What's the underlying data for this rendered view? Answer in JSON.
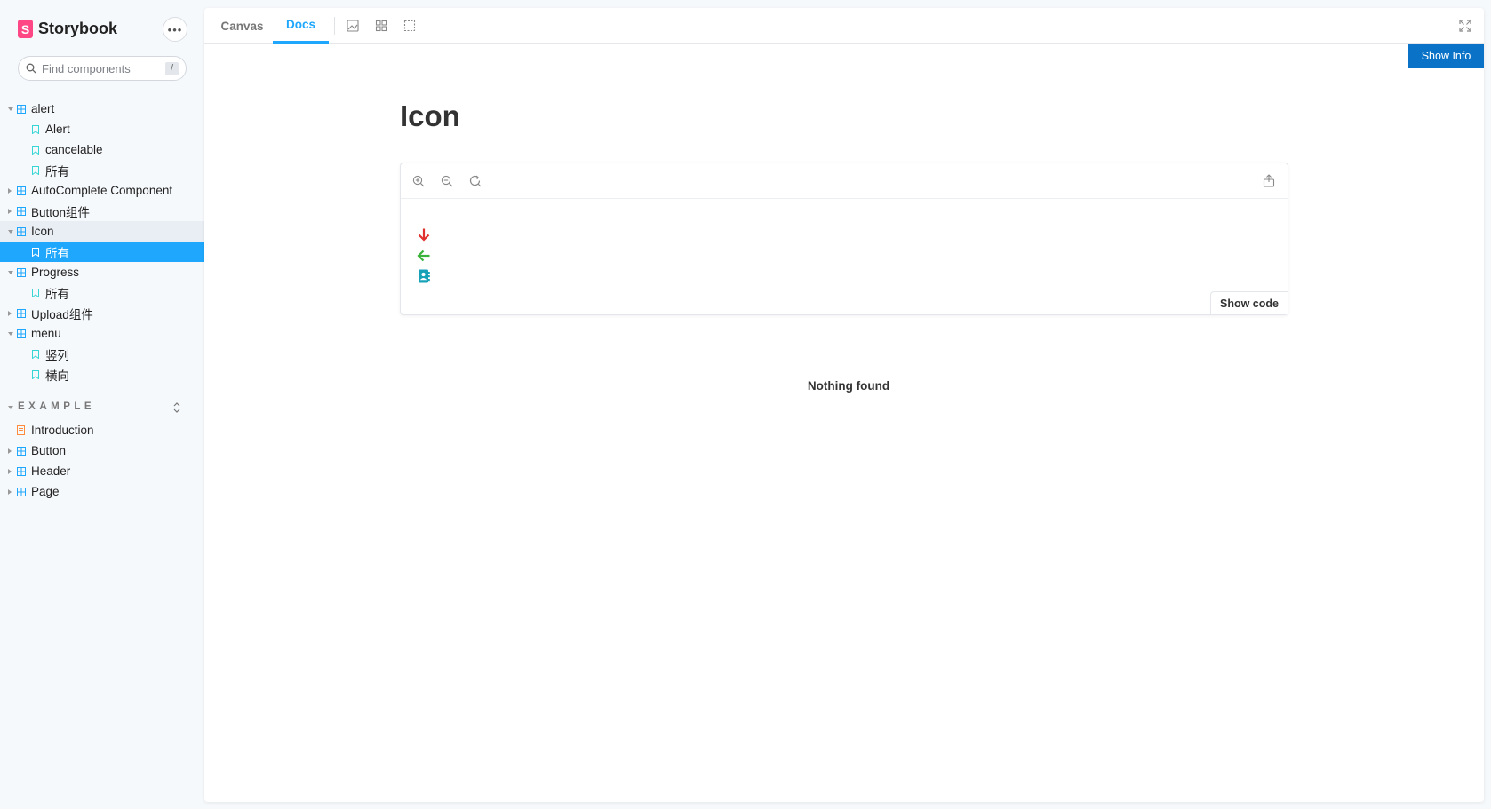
{
  "brand": {
    "name": "Storybook",
    "logo_letter": "S",
    "more_label": "•••"
  },
  "search": {
    "placeholder": "Find components",
    "shortcut": "/"
  },
  "tree": [
    {
      "label": "alert",
      "kind": "component",
      "expanded": true
    },
    {
      "label": "Alert",
      "kind": "story"
    },
    {
      "label": "cancelable",
      "kind": "story"
    },
    {
      "label": "所有",
      "kind": "story"
    },
    {
      "label": "AutoComplete Component",
      "kind": "component",
      "expanded": false
    },
    {
      "label": "Button组件",
      "kind": "component",
      "expanded": false
    },
    {
      "label": "Icon",
      "kind": "component",
      "expanded": true
    },
    {
      "label": "所有",
      "kind": "story",
      "selected": true
    },
    {
      "label": "Progress",
      "kind": "component",
      "expanded": true
    },
    {
      "label": "所有",
      "kind": "story"
    },
    {
      "label": "Upload组件",
      "kind": "component",
      "expanded": false
    },
    {
      "label": "menu",
      "kind": "component",
      "expanded": true
    },
    {
      "label": "竖列",
      "kind": "story"
    },
    {
      "label": "横向",
      "kind": "story"
    }
  ],
  "section": {
    "title": "EXAMPLE",
    "items": [
      {
        "label": "Introduction",
        "kind": "docs"
      },
      {
        "label": "Button",
        "kind": "component"
      },
      {
        "label": "Header",
        "kind": "component"
      },
      {
        "label": "Page",
        "kind": "component"
      }
    ]
  },
  "toolbar": {
    "tab_canvas": "Canvas",
    "tab_docs": "Docs",
    "active_tab": "Docs"
  },
  "show_info_label": "Show Info",
  "doc": {
    "title": "Icon",
    "show_code_label": "Show code",
    "empty_message": "Nothing found"
  },
  "icons": [
    "arrow-down-icon",
    "arrow-left-icon",
    "address-book-icon"
  ],
  "colors": {
    "accent": "#1ea7fd",
    "brand": "#ff4785",
    "info_button": "#0b73c7",
    "icon_red": "#e0312e",
    "icon_green": "#3bb33b",
    "icon_teal": "#17a2b8"
  }
}
